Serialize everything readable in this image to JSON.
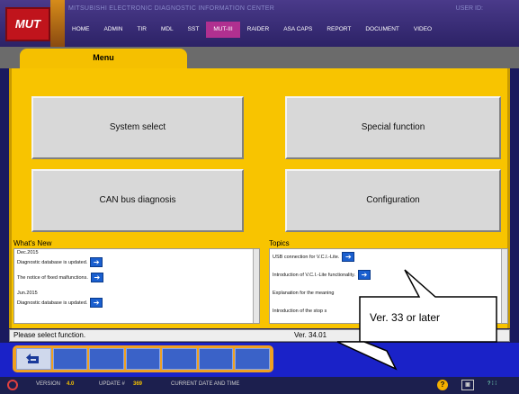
{
  "header": {
    "logo": "MUT",
    "center_title": "MITSUBISHI ELECTRONIC DIAGNOSTIC INFORMATION CENTER",
    "user_id": "USER ID:",
    "nav": [
      "HOME",
      "ADMIN",
      "TIR",
      "MDL",
      "SST",
      "MUT-III",
      "RAIDER",
      "ASA CAPS",
      "REPORT",
      "DOCUMENT",
      "VIDEO"
    ],
    "active_nav": "MUT-III"
  },
  "menu_tab": "Menu",
  "buttons": {
    "system_select": "System select",
    "special_function": "Special function",
    "can_bus": "CAN bus diagnosis",
    "configuration": "Configuration"
  },
  "whats_new": {
    "label": "What's New",
    "date1": "Dec.2015",
    "item1": "Diagnostic database is updated.",
    "item2": "The notice of fixed malfunctions.",
    "date2": "Jun.2015",
    "item3": "Diagnostic database is updated."
  },
  "topics": {
    "label": "Topics",
    "item1": "USB connection for V.C.I.-Lite.",
    "item2": "Introduction of V.C.I.-Lite functionality.",
    "item3": "Explanation for the meaning",
    "item4": "Introduction of the stop s"
  },
  "status": {
    "message": "Please select function.",
    "version": "Ver. 34.01"
  },
  "callout": "Ver. 33 or later",
  "footer": {
    "version_label": "VERSION",
    "version_value": "4.0",
    "update_label": "UPDATE #",
    "update_value": "369",
    "datetime_label": "CURRENT DATE AND TIME"
  },
  "colors": {
    "yellow": "#f8c400",
    "navy": "#1a22c8",
    "accent_tab": "#b03090"
  }
}
